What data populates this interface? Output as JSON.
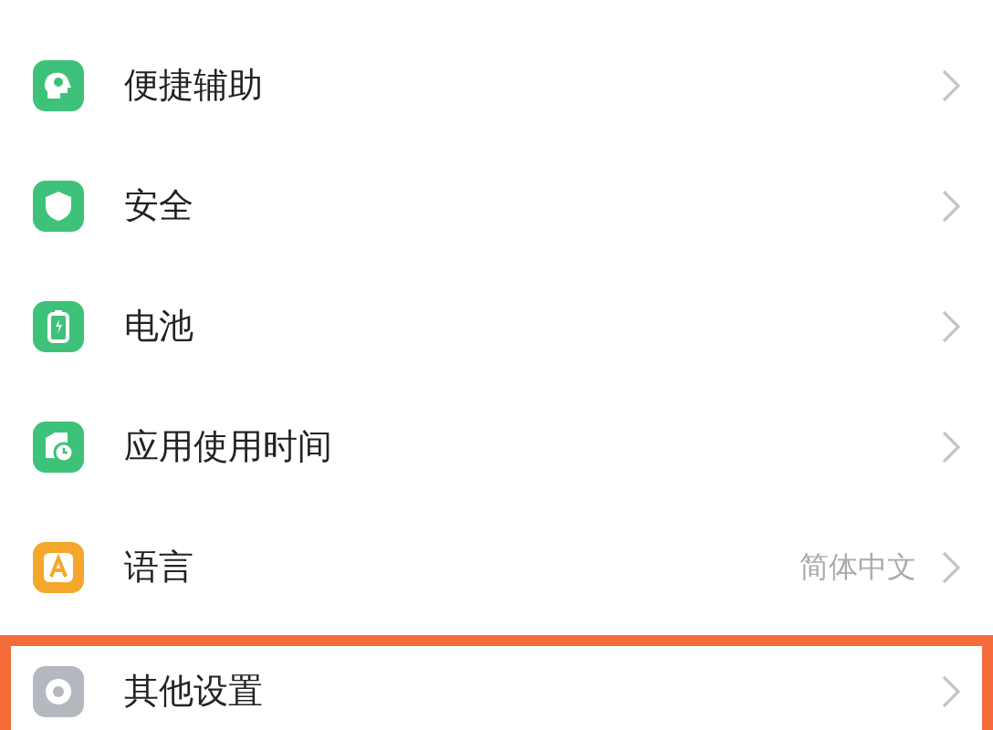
{
  "settings": [
    {
      "label": "便捷辅助",
      "color": "#3ec27a",
      "highlighted": false
    },
    {
      "label": "安全",
      "color": "#3ec27a",
      "highlighted": false
    },
    {
      "label": "电池",
      "color": "#3ec27a",
      "highlighted": false
    },
    {
      "label": "应用使用时间",
      "color": "#3ec27a",
      "highlighted": false
    },
    {
      "label": "语言",
      "color": "#f4a72b",
      "value": "简体中文",
      "highlighted": false
    },
    {
      "label": "其他设置",
      "color": "#b5b8bf",
      "highlighted": true
    }
  ]
}
